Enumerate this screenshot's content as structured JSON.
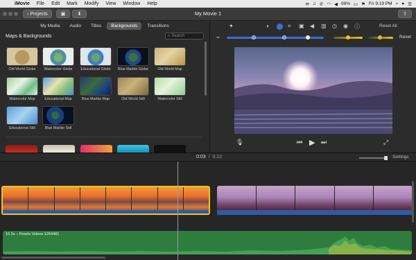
{
  "menubar": {
    "app": "iMovie",
    "items": [
      "File",
      "Edit",
      "Mark",
      "Modify",
      "View",
      "Window",
      "Help"
    ],
    "battery": "98%",
    "clock": "Fri 9:19 PM"
  },
  "toolbar": {
    "projects_label": "Projects",
    "window_title": "My Movie 1"
  },
  "browser": {
    "tabs": [
      "My Media",
      "Audio",
      "Titles",
      "Backgrounds",
      "Transitions"
    ],
    "active_tab": "Backgrounds",
    "section_title": "Maps & Backgrounds",
    "search_placeholder": "Search",
    "items": [
      {
        "label": "Old World Globe"
      },
      {
        "label": "Watercolor Globe"
      },
      {
        "label": "Educational Globe"
      },
      {
        "label": "Blue Marble Globe"
      },
      {
        "label": "Old World Map"
      },
      {
        "label": "Watercolor Map"
      },
      {
        "label": "Educational Map"
      },
      {
        "label": "Blue Marble Map"
      },
      {
        "label": "Old World Still"
      },
      {
        "label": "Watercolor Still"
      },
      {
        "label": "Educational Still"
      },
      {
        "label": "Blue Marble Still"
      }
    ]
  },
  "viewer": {
    "reset_all_label": "Reset All",
    "reset_label": "Reset"
  },
  "timeline": {
    "current_time": "0:03",
    "separator": "/",
    "total_time": "0:22",
    "settings_label": "Settings",
    "audio_clip_label": "16.3s – Pexels Videos 1264481"
  },
  "colors": {
    "accent_blue": "#3b6fd8",
    "selection_yellow": "#f0c419",
    "audio_green": "#2e7d3e"
  }
}
